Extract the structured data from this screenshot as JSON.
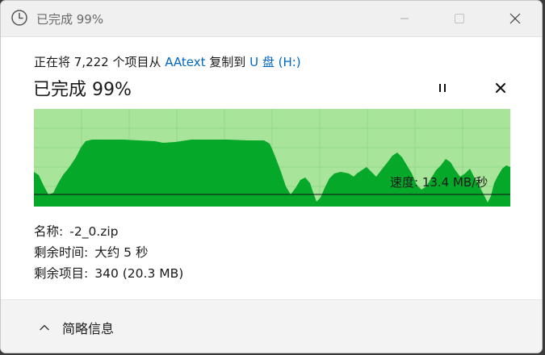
{
  "window": {
    "title": "已完成 99%",
    "controls": {
      "minimize": "minimize",
      "maximize": "maximize",
      "close": "close"
    }
  },
  "header": {
    "prefix": "正在将 7,222 个项目从 ",
    "source": "AAtext",
    "middle": " 复制到 ",
    "destination": "U 盘 (H:)"
  },
  "progress": {
    "heading": "已完成 99%",
    "percent": 99
  },
  "graph": {
    "speed_label": "速度: 13.4 MB/秒",
    "colors": {
      "background": "#a8e49a",
      "fill": "#06a829",
      "grid": "#95d889",
      "speed_line": "#111111"
    }
  },
  "details": {
    "name_label": "名称:",
    "name_value": "-2_0.zip",
    "time_label": "剩余时间:",
    "time_value": "大约 5 秒",
    "items_label": "剩余项目:",
    "items_value": "340 (20.3 MB)"
  },
  "footer": {
    "toggle_label": "简略信息"
  },
  "icons": [
    "clock-icon",
    "minimize-icon",
    "maximize-icon",
    "close-icon",
    "pause-icon",
    "cancel-icon",
    "chevron-up-icon"
  ]
}
